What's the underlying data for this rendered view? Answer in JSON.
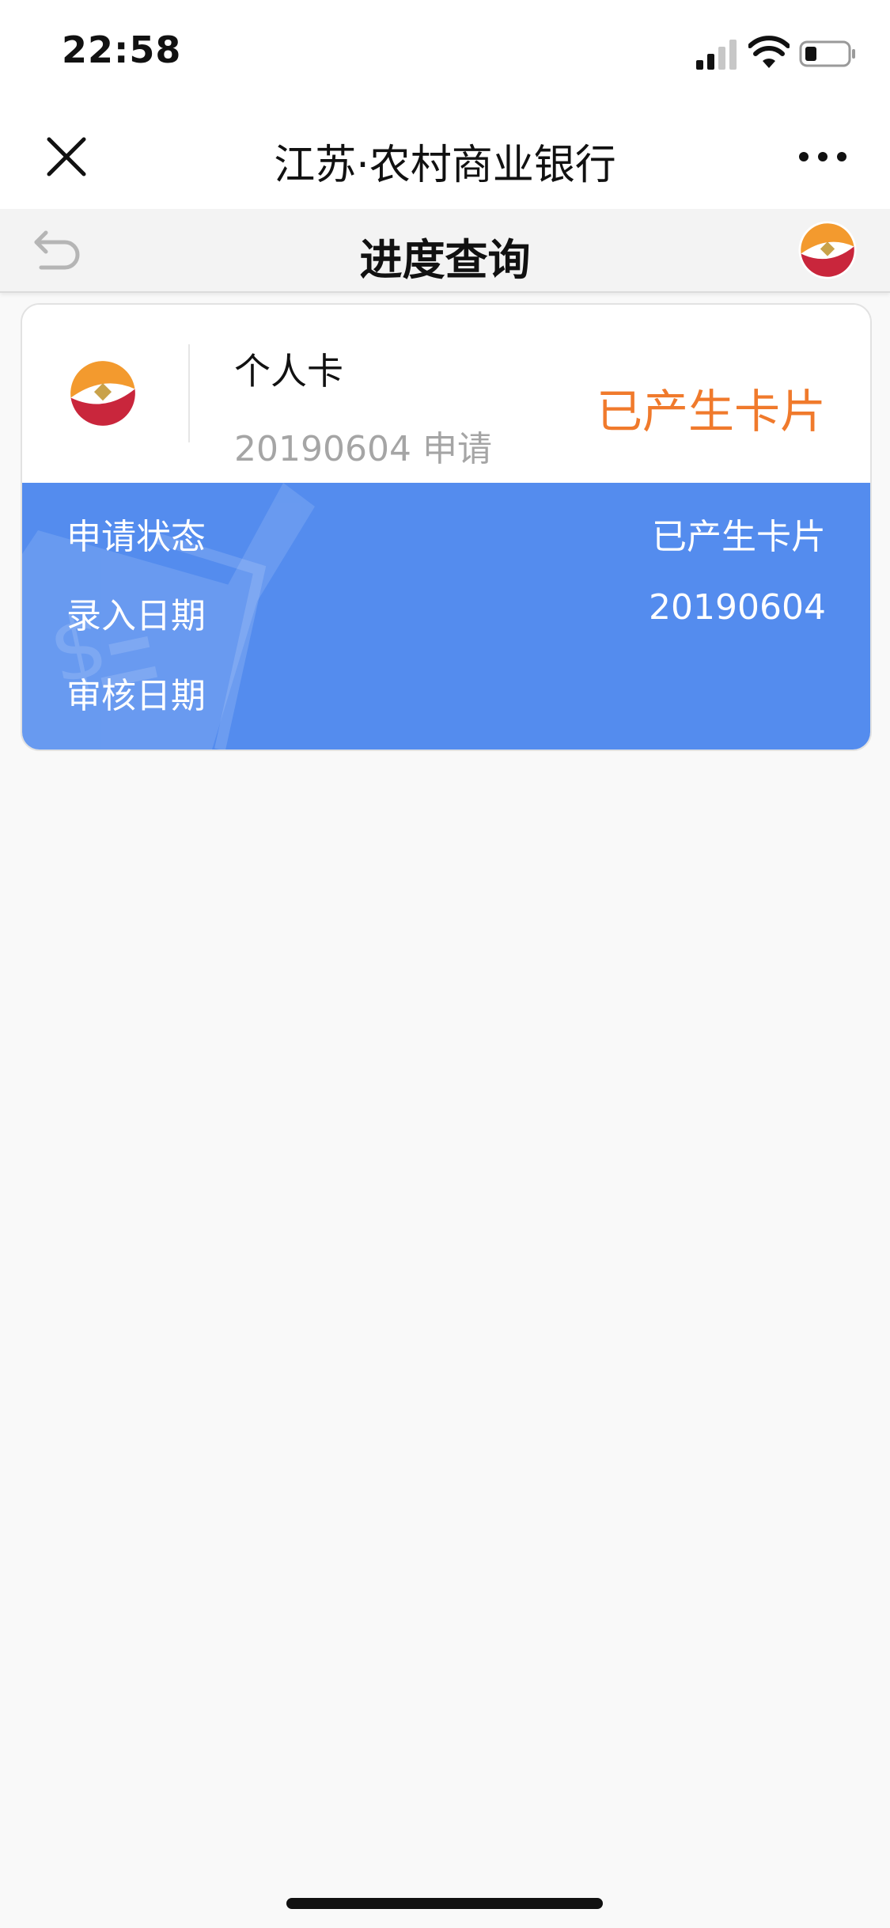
{
  "status_bar": {
    "time": "22:58"
  },
  "nav": {
    "title": "江苏·农村商业银行"
  },
  "subheader": {
    "title": "进度查询"
  },
  "card": {
    "name": "个人卡",
    "date_line": "20190604 申请",
    "status": "已产生卡片",
    "details": [
      {
        "label": "申请状态",
        "value": "已产生卡片"
      },
      {
        "label": "录入日期",
        "value": "20190604"
      },
      {
        "label": "审核日期",
        "value": ""
      }
    ]
  },
  "colors": {
    "accent_orange": "#f07a2c",
    "card_blue": "#548cee",
    "logo_orange": "#f39a2e",
    "logo_red": "#c9263c",
    "logo_gold": "#c9a24a"
  }
}
